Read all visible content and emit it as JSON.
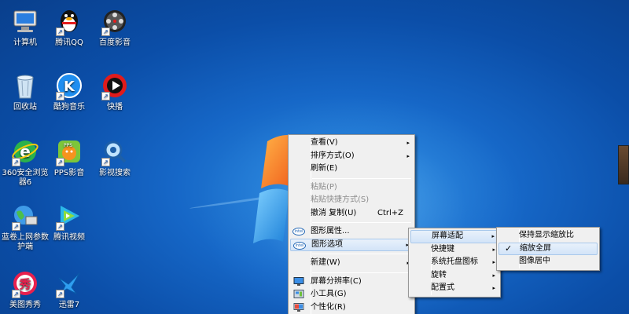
{
  "desktop_icons": [
    {
      "label": "计算机",
      "icon": "computer-icon",
      "shortcut": false
    },
    {
      "label": "腾讯QQ",
      "icon": "qq-penguin-icon",
      "shortcut": true
    },
    {
      "label": "百度影音",
      "icon": "film-reel-icon",
      "shortcut": true
    },
    {
      "label": "回收站",
      "icon": "recycle-bin-icon",
      "shortcut": false
    },
    {
      "label": "酷狗音乐",
      "icon": "kugou-k-icon",
      "shortcut": true
    },
    {
      "label": "快播",
      "icon": "qvod-play-icon",
      "shortcut": true
    },
    {
      "label": "360安全浏览器6",
      "icon": "browser-e-icon",
      "shortcut": true
    },
    {
      "label": "PPS影音",
      "icon": "pps-icon",
      "shortcut": true
    },
    {
      "label": "影视搜索",
      "icon": "film-search-icon",
      "shortcut": true
    },
    {
      "label": "蓝卷上网参数护端",
      "icon": "network-globe-icon",
      "shortcut": true
    },
    {
      "label": "腾讯视频",
      "icon": "tencent-video-icon",
      "shortcut": true
    },
    {
      "label": "美图秀秀",
      "icon": "meitu-xiu-icon",
      "shortcut": true
    },
    {
      "label": "迅雷7",
      "icon": "thunder-bird-icon",
      "shortcut": true
    }
  ],
  "main_menu": {
    "items": [
      {
        "label": "查看(V)",
        "submenu": true
      },
      {
        "label": "排序方式(O)",
        "submenu": true
      },
      {
        "label": "刷新(E)"
      },
      {
        "separator": true
      },
      {
        "label": "粘贴(P)",
        "disabled": true
      },
      {
        "label": "粘贴快捷方式(S)",
        "disabled": true
      },
      {
        "label": "撤消 复制(U)",
        "shortcut": "Ctrl+Z"
      },
      {
        "separator": true
      },
      {
        "label": "图形属性...",
        "icon": "intel-icon"
      },
      {
        "label": "图形选项",
        "icon": "intel-icon",
        "submenu": true,
        "highlighted": true
      },
      {
        "separator": true
      },
      {
        "label": "新建(W)",
        "submenu": true
      },
      {
        "separator": true
      },
      {
        "label": "屏幕分辨率(C)",
        "icon": "display-icon"
      },
      {
        "label": "小工具(G)",
        "icon": "gadgets-icon"
      },
      {
        "label": "个性化(R)",
        "icon": "personalize-icon"
      }
    ]
  },
  "graphics_submenu": {
    "items": [
      {
        "label": "屏幕适配",
        "submenu": true,
        "highlighted": true
      },
      {
        "label": "快捷键",
        "submenu": true
      },
      {
        "label": "系统托盘图标",
        "submenu": true
      },
      {
        "label": "旋转",
        "submenu": true
      },
      {
        "label": "配置式",
        "submenu": true
      }
    ]
  },
  "fit_submenu": {
    "items": [
      {
        "label": "保持显示缩放比"
      },
      {
        "label": "缩放全屏",
        "checked": true,
        "highlighted": true
      },
      {
        "label": "图像居中"
      }
    ]
  },
  "symbols": {
    "arrow": "▸",
    "check": "✓",
    "shortcut_arrow": "↗",
    "intel": "intel"
  }
}
